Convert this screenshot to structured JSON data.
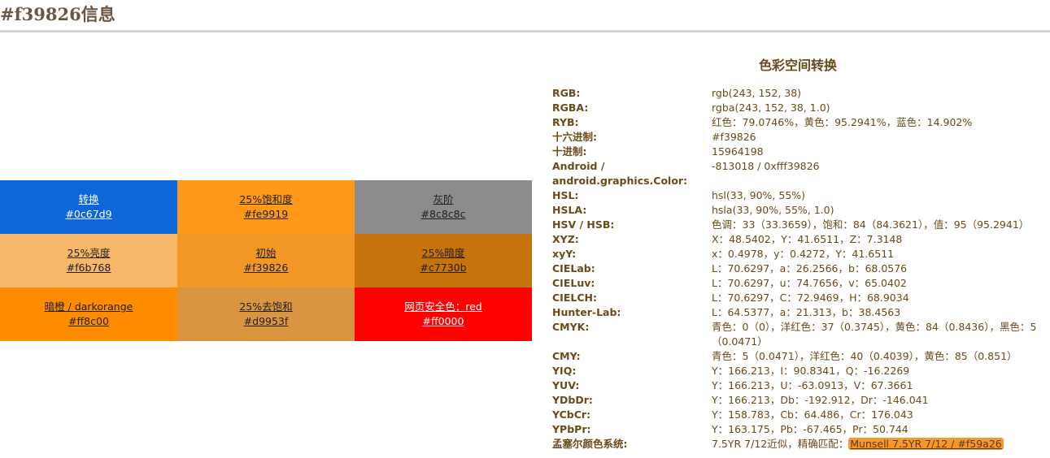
{
  "page": {
    "title": "#f39826信息"
  },
  "swatches": [
    {
      "label": "转换",
      "hex": "#0c67d9",
      "bg": "#0c67d9",
      "text": "light"
    },
    {
      "label": "25%饱和度",
      "hex": "#fe9919",
      "bg": "#fe9919",
      "text": "dark"
    },
    {
      "label": "灰阶",
      "hex": "#8c8c8c",
      "bg": "#8c8c8c",
      "text": "dark"
    },
    {
      "label": "25%亮度",
      "hex": "#f6b768",
      "bg": "#f6b768",
      "text": "dark"
    },
    {
      "label": "初始",
      "hex": "#f39826",
      "bg": "#f39826",
      "text": "dark"
    },
    {
      "label": "25%暗度",
      "hex": "#c7730b",
      "bg": "#c7730b",
      "text": "dark"
    },
    {
      "label": "暗橙 / darkorange",
      "hex": "#ff8c00",
      "bg": "#ff8c00",
      "text": "dark"
    },
    {
      "label": "25%去饱和",
      "hex": "#d9953f",
      "bg": "#d9953f",
      "text": "dark"
    },
    {
      "label": "网页安全色：red",
      "hex": "#ff0000",
      "bg": "#ff0000",
      "text": "light"
    }
  ],
  "info": {
    "heading": "色彩空间转换",
    "rows": [
      {
        "label": "RGB:",
        "value": "rgb(243, 152, 38)"
      },
      {
        "label": "RGBA:",
        "value": "rgba(243, 152, 38, 1.0)"
      },
      {
        "label": "RYB:",
        "value": "红色：79.0746%，黄色：95.2941%，蓝色：14.902%"
      },
      {
        "label": "十六进制:",
        "value": "#f39826"
      },
      {
        "label": "十进制:",
        "value": "15964198"
      },
      {
        "label": "Android / android.graphics.Color:",
        "value": "-813018 / 0xfff39826"
      },
      {
        "label": "HSL:",
        "value": "hsl(33, 90%, 55%)"
      },
      {
        "label": "HSLA:",
        "value": "hsla(33, 90%, 55%, 1.0)"
      },
      {
        "label": "HSV / HSB:",
        "value": "色调：33（33.3659），饱和：84（84.3621），值：95（95.2941）"
      },
      {
        "label": "XYZ:",
        "value": "X：48.5402，Y：41.6511，Z：7.3148"
      },
      {
        "label": "xyY:",
        "value": "x：0.4978，y：0.4272，Y：41.6511"
      },
      {
        "label": "CIELab:",
        "value": "L：70.6297，a：26.2566，b：68.0576"
      },
      {
        "label": "CIELuv:",
        "value": "L：70.6297，u：74.7656，v：65.0402"
      },
      {
        "label": "CIELCH:",
        "value": "L：70.6297，C：72.9469，H：68.9034"
      },
      {
        "label": "Hunter-Lab:",
        "value": "L：64.5377，a：21.313，b：38.4563"
      },
      {
        "label": "CMYK:",
        "value": "青色：0（0），洋红色：37（0.3745），黄色：84（0.8436），黑色：5（0.0471）"
      },
      {
        "label": "CMY:",
        "value": "青色：5（0.0471），洋红色：40（0.4039），黄色：85（0.851）"
      },
      {
        "label": "YIQ:",
        "value": "Y：166.213，I：90.8341，Q：-16.2269"
      },
      {
        "label": "YUV:",
        "value": "Y：166.213，U：-63.0913，V：67.3661"
      },
      {
        "label": "YDbDr:",
        "value": "Y：166.213，Db：-192.912，Dr：-146.041"
      },
      {
        "label": "YCbCr:",
        "value": "Y：158.783，Cb：64.486，Cr：176.043"
      },
      {
        "label": "YPbPr:",
        "value": "Y：163.175，Pb：-67.465，Pr：50.744"
      }
    ],
    "munsell": {
      "label": "孟塞尔颜色系统:",
      "prefix": "7.5YR 7/12近似，精确匹配：",
      "link": "Munsell 7.5YR 7/12 / #f59a26"
    }
  }
}
